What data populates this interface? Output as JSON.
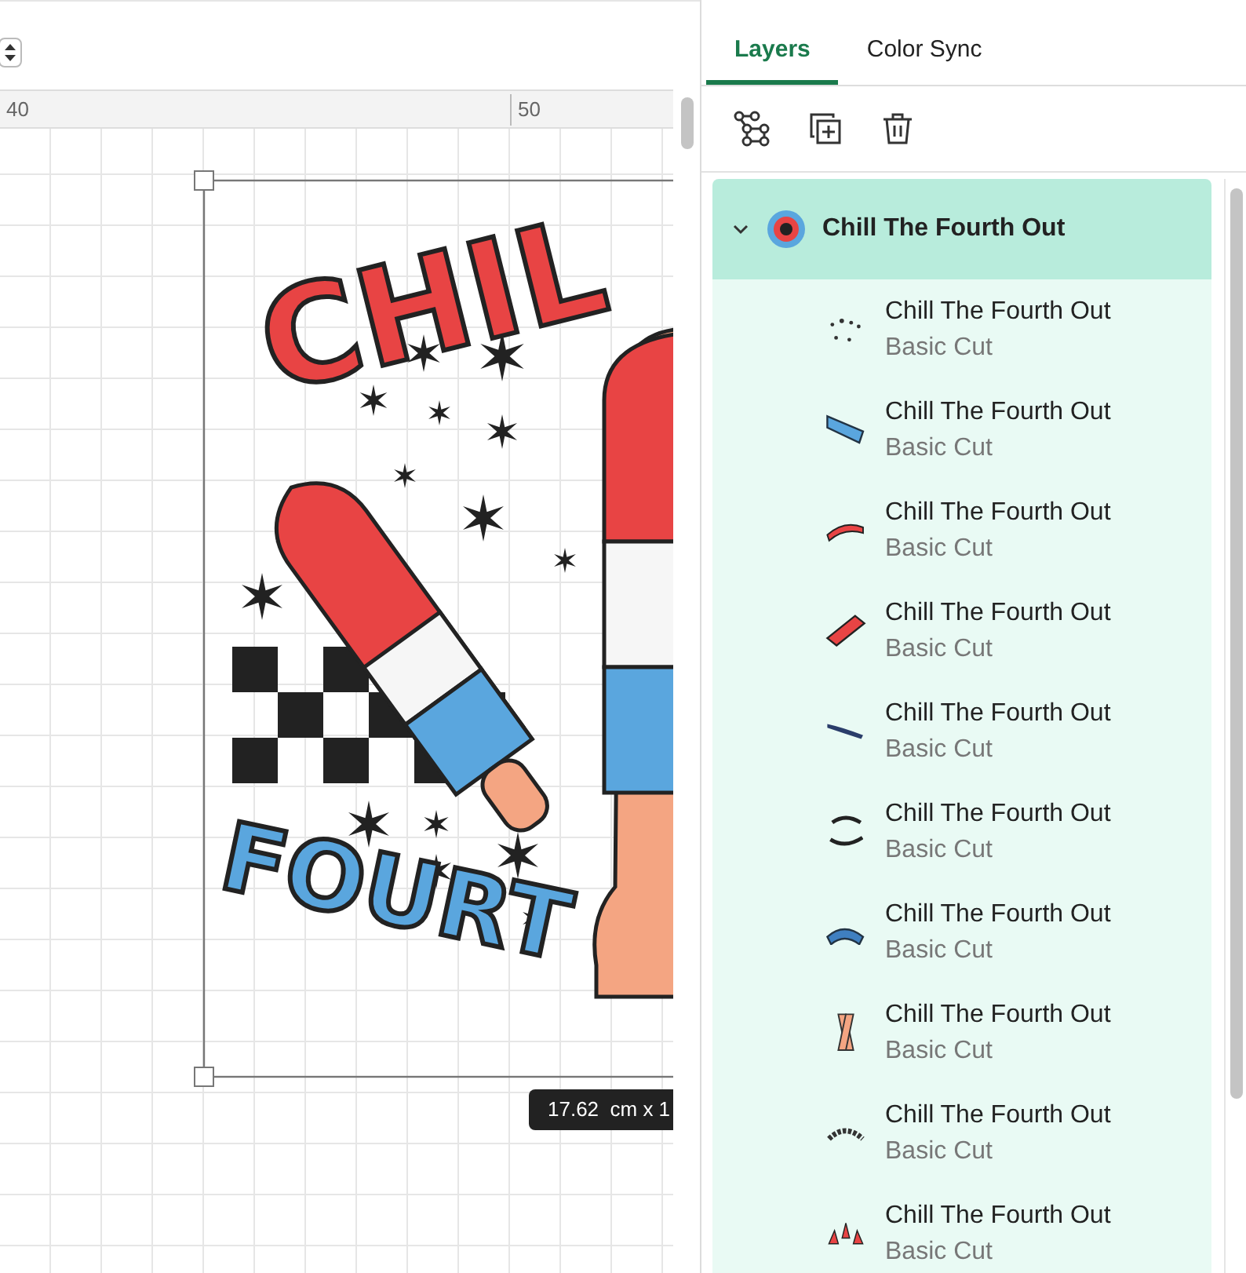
{
  "canvas": {
    "ruler": [
      "40",
      "50"
    ],
    "artwork": {
      "top_text": "CHIL",
      "bottom_text": "FOURT"
    },
    "size_label": "17.62  cm x 1"
  },
  "panel": {
    "tabs": [
      {
        "label": "Layers",
        "selected": true
      },
      {
        "label": "Color Sync",
        "selected": false
      }
    ],
    "group": {
      "name": "Chill The Fourth Out",
      "expanded": true,
      "selected": true,
      "children": [
        {
          "name": "Chill The Fourth Out",
          "operation": "Basic Cut"
        },
        {
          "name": "Chill The Fourth Out",
          "operation": "Basic Cut"
        },
        {
          "name": "Chill The Fourth Out",
          "operation": "Basic Cut"
        },
        {
          "name": "Chill The Fourth Out",
          "operation": "Basic Cut"
        },
        {
          "name": "Chill The Fourth Out",
          "operation": "Basic Cut"
        },
        {
          "name": "Chill The Fourth Out",
          "operation": "Basic Cut"
        },
        {
          "name": "Chill The Fourth Out",
          "operation": "Basic Cut"
        },
        {
          "name": "Chill The Fourth Out",
          "operation": "Basic Cut"
        },
        {
          "name": "Chill The Fourth Out",
          "operation": "Basic Cut"
        },
        {
          "name": "Chill The Fourth Out",
          "operation": "Basic Cut"
        }
      ]
    }
  }
}
